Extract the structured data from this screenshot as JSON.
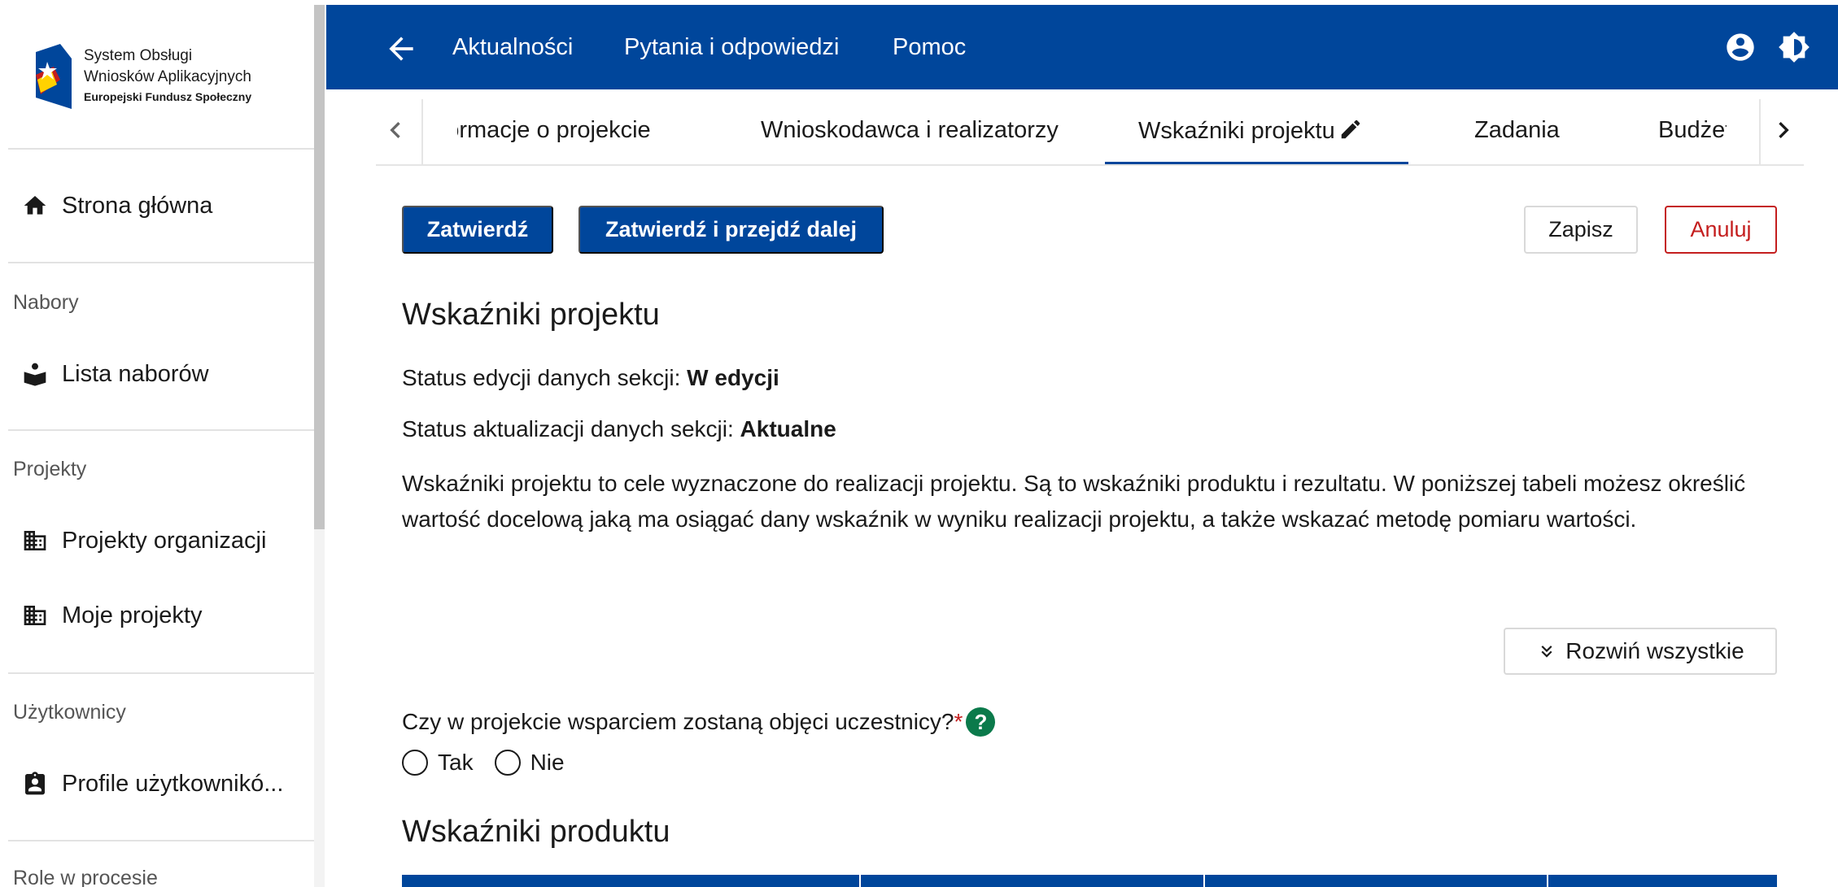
{
  "logo": {
    "line1": "System Obsługi",
    "line2": "Wniosków Aplikacyjnych",
    "line3": "Europejski Fundusz Społeczny"
  },
  "sidebar": {
    "home": "Strona główna",
    "sections": {
      "nabory": "Nabory",
      "projekty": "Projekty",
      "uzytkownicy": "Użytkownicy",
      "role": "Role w procesie"
    },
    "items": {
      "lista_naborow": "Lista naborów",
      "projekty_organizacji": "Projekty organizacji",
      "moje_projekty": "Moje projekty",
      "profile": "Profile użytkownikó..."
    }
  },
  "topbar": {
    "links": [
      "Aktualności",
      "Pytania i odpowiedzi",
      "Pomoc"
    ],
    "colors": {
      "background": "#00469b"
    }
  },
  "tabs": {
    "items": [
      "Informacje o projekcie",
      "Wnioskodawca i realizatorzy",
      "Wskaźniki projektu",
      "Zadania",
      "Budżet pr"
    ],
    "active_index": 2
  },
  "actions": {
    "confirm": "Zatwierdź",
    "confirm_next": "Zatwierdź i przejdź dalej",
    "save": "Zapisz",
    "cancel": "Anuluj"
  },
  "main": {
    "title": "Wskaźniki projektu",
    "status_edit_label": "Status edycji danych sekcji: ",
    "status_edit_value": "W edycji",
    "status_update_label": "Status aktualizacji danych sekcji: ",
    "status_update_value": "Aktualne",
    "description": "Wskaźniki projektu to cele wyznaczone do realizacji projektu. Są to wskaźniki produktu i rezultatu. W poniższej tabeli możesz określić wartość docelową jaką ma osiągać dany wskaźnik w wyniku realizacji projektu, a także wskazać metodę pomiaru wartości.",
    "expand_all": "Rozwiń wszystkie",
    "question": "Czy w projekcie wsparciem zostaną objęci uczestnicy?",
    "required_mark": "*",
    "help_glyph": "?",
    "options": [
      "Tak",
      "Nie"
    ],
    "section2_title": "Wskaźniki produktu"
  },
  "icons": {
    "back": "arrow-left-icon",
    "account": "account-circle-icon",
    "contrast": "brightness-icon",
    "home": "home-icon",
    "list": "book-hand-icon",
    "building": "building-icon",
    "profile": "badge-icon",
    "edit": "pencil-icon",
    "expand": "double-chevron-down-icon"
  }
}
